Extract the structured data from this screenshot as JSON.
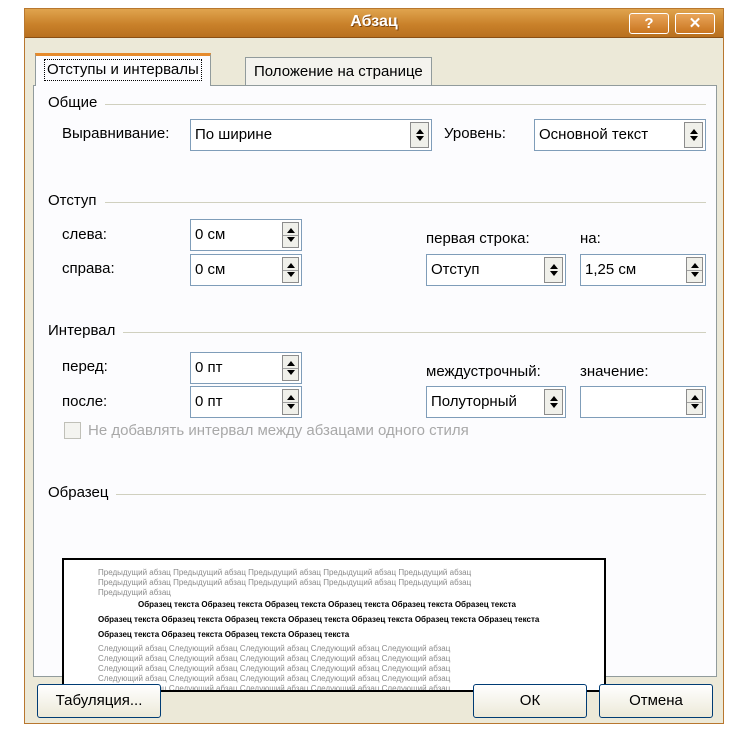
{
  "window": {
    "title": "Абзац",
    "help_label": "?",
    "close_label": "✕"
  },
  "tabs": [
    {
      "label": "Отступы и интервалы",
      "active": true
    },
    {
      "label": "Положение на странице",
      "active": false
    }
  ],
  "general": {
    "group_label": "Общие",
    "alignment_label": "Выравнивание:",
    "alignment_value": "По ширине",
    "level_label": "Уровень:",
    "level_value": "Основной текст"
  },
  "indent": {
    "group_label": "Отступ",
    "left_label": "слева:",
    "left_value": "0 см",
    "right_label": "справа:",
    "right_value": "0 см",
    "first_line_label": "первая строка:",
    "first_line_value": "Отступ",
    "by_label": "на:",
    "by_value": "1,25 см"
  },
  "spacing": {
    "group_label": "Интервал",
    "before_label": "перед:",
    "before_value": "0 пт",
    "after_label": "после:",
    "after_value": "0 пт",
    "line_spacing_label": "междустрочный:",
    "line_spacing_value": "Полуторный",
    "at_label": "значение:",
    "at_value": "",
    "no_space_label": "Не добавлять интервал между абзацами одного стиля",
    "no_space_checked": false
  },
  "preview": {
    "group_label": "Образец",
    "prev_lines": [
      "Предыдущий абзац Предыдущий абзац Предыдущий абзац Предыдущий абзац Предыдущий абзац",
      "Предыдущий абзац Предыдущий абзац Предыдущий абзац Предыдущий абзац Предыдущий абзац",
      "Предыдущий абзац"
    ],
    "sample_lines": [
      "Образец текста Образец текста Образец текста Образец текста Образец текста Образец текста",
      "Образец текста Образец текста Образец текста Образец текста Образец текста Образец текста Образец текста",
      "Образец текста Образец текста Образец текста Образец текста"
    ],
    "next_lines": [
      "Следующий абзац Следующий абзац Следующий абзац Следующий абзац Следующий абзац",
      "Следующий абзац Следующий абзац Следующий абзац Следующий абзац Следующий абзац",
      "Следующий абзац Следующий абзац Следующий абзац Следующий абзац Следующий абзац",
      "Следующий абзац Следующий абзац Следующий абзац Следующий абзац Следующий абзац",
      "Следующий абзац Следующий абзац Следующий абзац Следующий абзац Следующий абзац"
    ]
  },
  "buttons": {
    "tabs_label": "Табуляция...",
    "ok_label": "ОК",
    "cancel_label": "Отмена"
  },
  "colors": {
    "titlebar": "#c9812a",
    "dialog_bg": "#ece9d8",
    "active_tab_accent": "#e68b2c"
  }
}
